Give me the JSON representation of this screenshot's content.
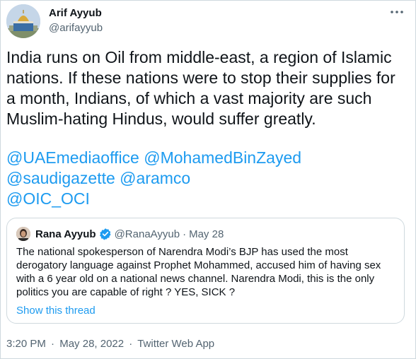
{
  "tweet": {
    "display_name": "Arif Ayyub",
    "handle": "@arifayyub",
    "text": "India runs on Oil from middle-east, a region of Islamic nations. If these nations were to stop their supplies for a month, Indians, of which a vast majority are such Muslim-hating Hindus, would suffer greatly.",
    "mentions": [
      "@UAEmediaoffice",
      "@MohamedBinZayed",
      "@saudigazette",
      "@aramco",
      "@OIC_OCI"
    ],
    "time": "3:20 PM",
    "separator": "·",
    "date": "May 28, 2022",
    "source": "Twitter Web App",
    "more_icon": "more-horizontal-icon"
  },
  "quote": {
    "display_name": "Rana Ayyub",
    "handle": "@RanaAyyub",
    "separator": "·",
    "date": "May 28",
    "text": "The national spokesperson of Narendra Modi’s BJP has used the most derogatory language against Prophet Mohammed, accused him of having sex with a 6 year old on a national news channel. Narendra Modi, this is the only politics you are capable of right ? YES, SICK ?",
    "show_thread": "Show this thread",
    "verified_icon": "verified-badge-icon"
  },
  "colors": {
    "text": "#0f1419",
    "secondary": "#536471",
    "link": "#1d9bf0",
    "border": "#cfd9de"
  }
}
